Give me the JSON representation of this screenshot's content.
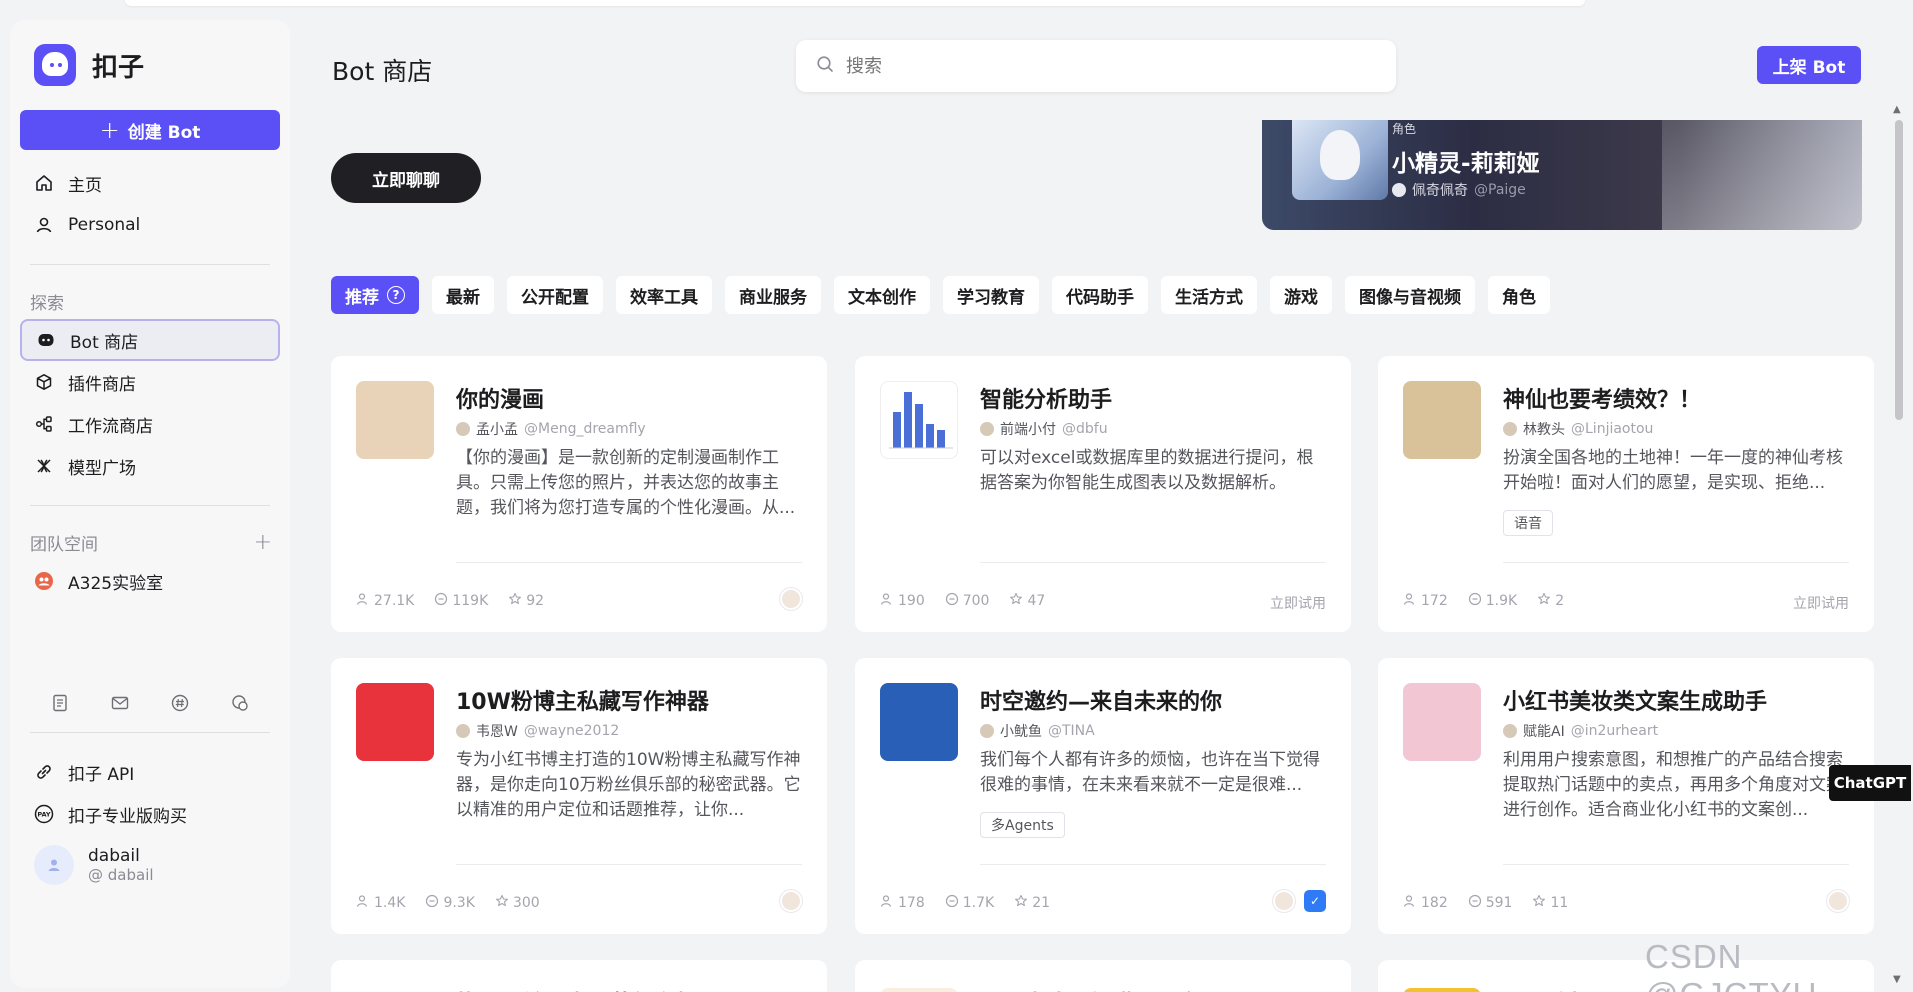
{
  "app": {
    "name": "扣子"
  },
  "sidebar": {
    "create_label": "创建 Bot",
    "nav_top": [
      {
        "label": "主页",
        "icon": "home-icon"
      },
      {
        "label": "Personal",
        "icon": "user-icon"
      }
    ],
    "explore_title": "探索",
    "explore": [
      {
        "label": "Bot 商店",
        "icon": "bot-icon"
      },
      {
        "label": "插件商店",
        "icon": "cube-icon"
      },
      {
        "label": "工作流商店",
        "icon": "workflow-icon"
      },
      {
        "label": "模型广场",
        "icon": "model-icon"
      }
    ],
    "team_title": "团队空间",
    "team": [
      {
        "label": "A325实验室"
      }
    ],
    "bottom": [
      {
        "label": "扣子 API"
      },
      {
        "label": "扣子专业版购买"
      }
    ],
    "user": {
      "name": "dabail",
      "handle": "@ dabail"
    }
  },
  "header": {
    "title": "Bot 商店",
    "search_placeholder": "搜索",
    "publish_label": "上架 Bot"
  },
  "hero": {
    "chat_now_label": "立即聊聊",
    "banner": {
      "tag": "角色",
      "title": "小精灵-莉莉娅",
      "author": "佩奇佩奇",
      "handle": "@Paige"
    }
  },
  "tabs": [
    "推荐",
    "最新",
    "公开配置",
    "效率工具",
    "商业服务",
    "文本创作",
    "学习教育",
    "代码助手",
    "生活方式",
    "游戏",
    "图像与音视频",
    "角色"
  ],
  "tab_help_symbol": "?",
  "cards": [
    {
      "title": "你的漫画",
      "author": "孟小孟",
      "handle": "@Meng_dreamfly",
      "desc": "【你的漫画】是一款创新的定制漫画制作工具。只需上传您的照片，并表达您的故事主题，我们将为您打造专属的个性化漫画。从...",
      "tag": "",
      "users": "27.1K",
      "chats": "119K",
      "stars": "92",
      "try_label": "",
      "thumb_color": "#e8d3b8"
    },
    {
      "title": "智能分析助手",
      "author": "前端小付",
      "handle": "@dbfu",
      "desc": "可以对excel或数据库里的数据进行提问，根据答案为你智能生成图表以及数据解析。",
      "tag": "",
      "users": "190",
      "chats": "700",
      "stars": "47",
      "try_label": "立即试用",
      "thumb_color": "#ffffff"
    },
    {
      "title": "神仙也要考绩效？！",
      "author": "林教头",
      "handle": "@Linjiaotou",
      "desc": "扮演全国各地的土地神！一年一度的神仙考核开始啦！面对人们的愿望，是实现、拒绝...",
      "tag": "语音",
      "users": "172",
      "chats": "1.9K",
      "stars": "2",
      "try_label": "立即试用",
      "thumb_color": "#d9c29a"
    },
    {
      "title": "10W粉博主私藏写作神器",
      "author": "韦恩W",
      "handle": "@wayne2012",
      "desc": "专为小红书博主打造的10W粉博主私藏写作神器，是你走向10万粉丝俱乐部的秘密武器。它以精准的用户定位和话题推荐，让你...",
      "tag": "",
      "users": "1.4K",
      "chats": "9.3K",
      "stars": "300",
      "try_label": "",
      "thumb_color": "#e8323c"
    },
    {
      "title": "时空邀约—来自未来的你",
      "author": "小鱿鱼",
      "handle": "@TINA",
      "desc": "我们每个人都有许多的烦恼，也许在当下觉得很难的事情，在未来看来就不一定是很难...",
      "tag": "多Agents",
      "users": "178",
      "chats": "1.7K",
      "stars": "21",
      "try_label": "",
      "thumb_color": "#2a5fb8"
    },
    {
      "title": "小红书美妆类文案生成助手",
      "author": "赋能AI",
      "handle": "@in2urheart",
      "desc": "利用用户搜索意图，和想推广的产品结合搜索提取热门话题中的卖点，再用多个角度对文案进行创作。适合商业化小红书的文案创...",
      "tag": "",
      "users": "182",
      "chats": "591",
      "stars": "11",
      "try_label": "",
      "thumb_color": "#f3c6d4"
    },
    {
      "title": "找元思做二十四节气海报",
      "author": "",
      "handle": "",
      "desc": "",
      "tag": "",
      "users": "",
      "chats": "",
      "stars": "",
      "try_label": "",
      "thumb_color": "#ffffff"
    },
    {
      "title": "漫画生成：橘猫漫画家",
      "author": "",
      "handle": "",
      "desc": "",
      "tag": "",
      "users": "",
      "chats": "",
      "stars": "",
      "try_label": "",
      "thumb_color": "#f8efe0"
    },
    {
      "title": "小雪选机",
      "author": "",
      "handle": "",
      "desc": "",
      "tag": "",
      "users": "",
      "chats": "",
      "stars": "",
      "try_label": "",
      "thumb_color": "#f2c230"
    }
  ],
  "overlay": {
    "chatgpt_label": "ChatGPT",
    "watermark": "CSDN @GJCTYU"
  },
  "colors": {
    "accent": "#5b4ff6",
    "dark": "#1f1f24"
  }
}
